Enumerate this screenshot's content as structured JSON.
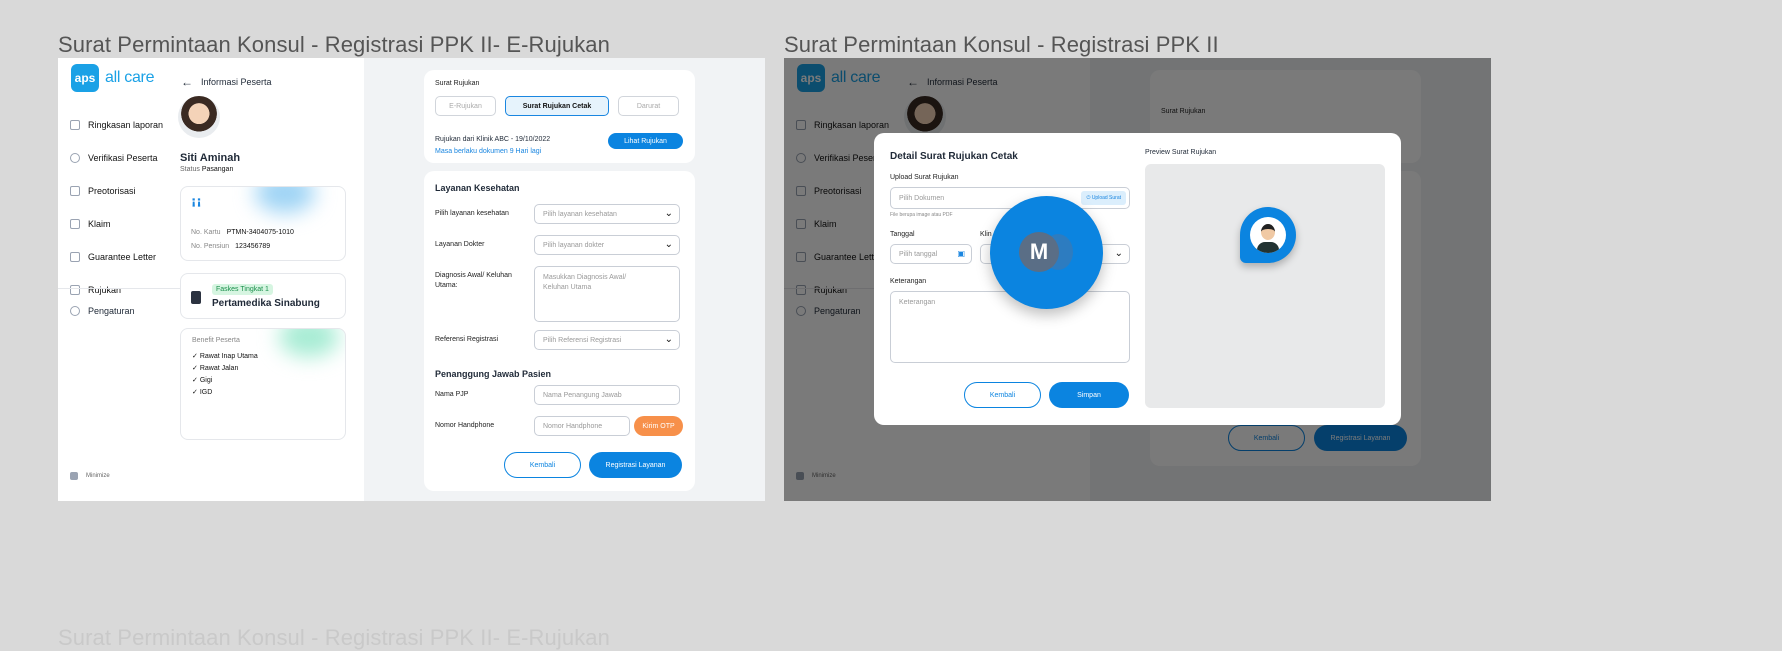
{
  "frame1_title": "Surat Permintaan Konsul - Registrasi PPK II- E-Rujukan",
  "frame2_title": "Surat Permintaan Konsul - Registrasi PPK II",
  "bottom_title": "Surat Permintaan Konsul - Registrasi PPK II- E-Rujukan",
  "colors": {
    "primary": "#0b84e0",
    "accent_orange": "#f7904a",
    "chip_green": "#1a8f4b"
  },
  "logo": {
    "badge": "aps",
    "text": "all care"
  },
  "sidebar": {
    "items": [
      {
        "label": "Ringkasan laporan",
        "icon": "grid-icon"
      },
      {
        "label": "Verifikasi Peserta",
        "icon": "user-icon"
      },
      {
        "label": "Preotorisasi",
        "icon": "document-icon"
      },
      {
        "label": "Klaim",
        "icon": "search-document-icon"
      },
      {
        "label": "Guarantee Letter",
        "icon": "shield-icon"
      },
      {
        "label": "Rujukan",
        "icon": "document-icon"
      }
    ],
    "settings": "Pengaturan",
    "minimize": "Minimize"
  },
  "info": {
    "back_label": "Informasi Peserta",
    "name": "Siti Aminah",
    "status_label": "Status",
    "status_value": "Pasangan",
    "card_no_label": "No. Kartu",
    "card_no_value": "PTMN-3404075-1010",
    "pension_label": "No. Pensiun",
    "pension_value": "123456789",
    "faskes_chip": "Faskes Tingkat 1",
    "hospital": "Pertamedika Sinabung",
    "benefit_title": "Benefit Peserta",
    "benefits": [
      "Rawat Inap Utama",
      "Rawat Jalan",
      "Gigi",
      "IGD"
    ]
  },
  "form": {
    "surat_rujukan_label": "Surat Rujukan",
    "tabs": [
      "E-Rujukan",
      "Surat Rujukan Cetak",
      "Darurat"
    ],
    "rujukan_text": "Rujukan dari Klinik ABC - 19/10/2022",
    "rujukan_warning": "Masa berlaku dokumen 9 Hari lagi",
    "lihat_rujukan": "Lihat Rujukan",
    "layanan_title": "Layanan Kesehatan",
    "pilih_layanan_label": "Pilih layanan kesehatan",
    "pilih_layanan_placeholder": "Pilih layanan kesehatan",
    "layanan_dokter_label": "Layanan Dokter",
    "layanan_dokter_placeholder": "Pilih layanan dokter",
    "diagnosis_label": "Diagnosis Awal/ Keluhan Utama:",
    "diagnosis_placeholder": "Masukkan Diagnosis Awal/ Keluhan Utama",
    "referensi_label": "Referensi Registrasi",
    "referensi_placeholder": "Pilih Referensi Registrasi",
    "pj_title": "Penanggung Jawab Pasien",
    "nama_pjp_label": "Nama PJP",
    "nama_pjp_placeholder": "Nama Penangung Jawab",
    "hp_label": "Nomor Handphone",
    "hp_placeholder": "Nomor Handphone",
    "kirim_otp": "Kirim OTP",
    "kembali": "Kembali",
    "registrasi": "Registrasi Layanan"
  },
  "modal": {
    "title": "Detail Surat Rujukan Cetak",
    "upload_label": "Upload Surat Rujukan",
    "upload_placeholder": "Pilih Dokumen",
    "upload_button": "Upload Surat",
    "hint": "File berupa image atau PDF",
    "tanggal_label": "Tanggal",
    "tanggal_placeholder": "Pilih tanggal",
    "klinik_label": "Klin",
    "keterangan_label": "Keterangan",
    "keterangan_placeholder": "Keterangan",
    "preview_title": "Preview Surat Rujukan",
    "kembali": "Kembali",
    "simpan": "Simpan",
    "fab_letter": "M"
  }
}
